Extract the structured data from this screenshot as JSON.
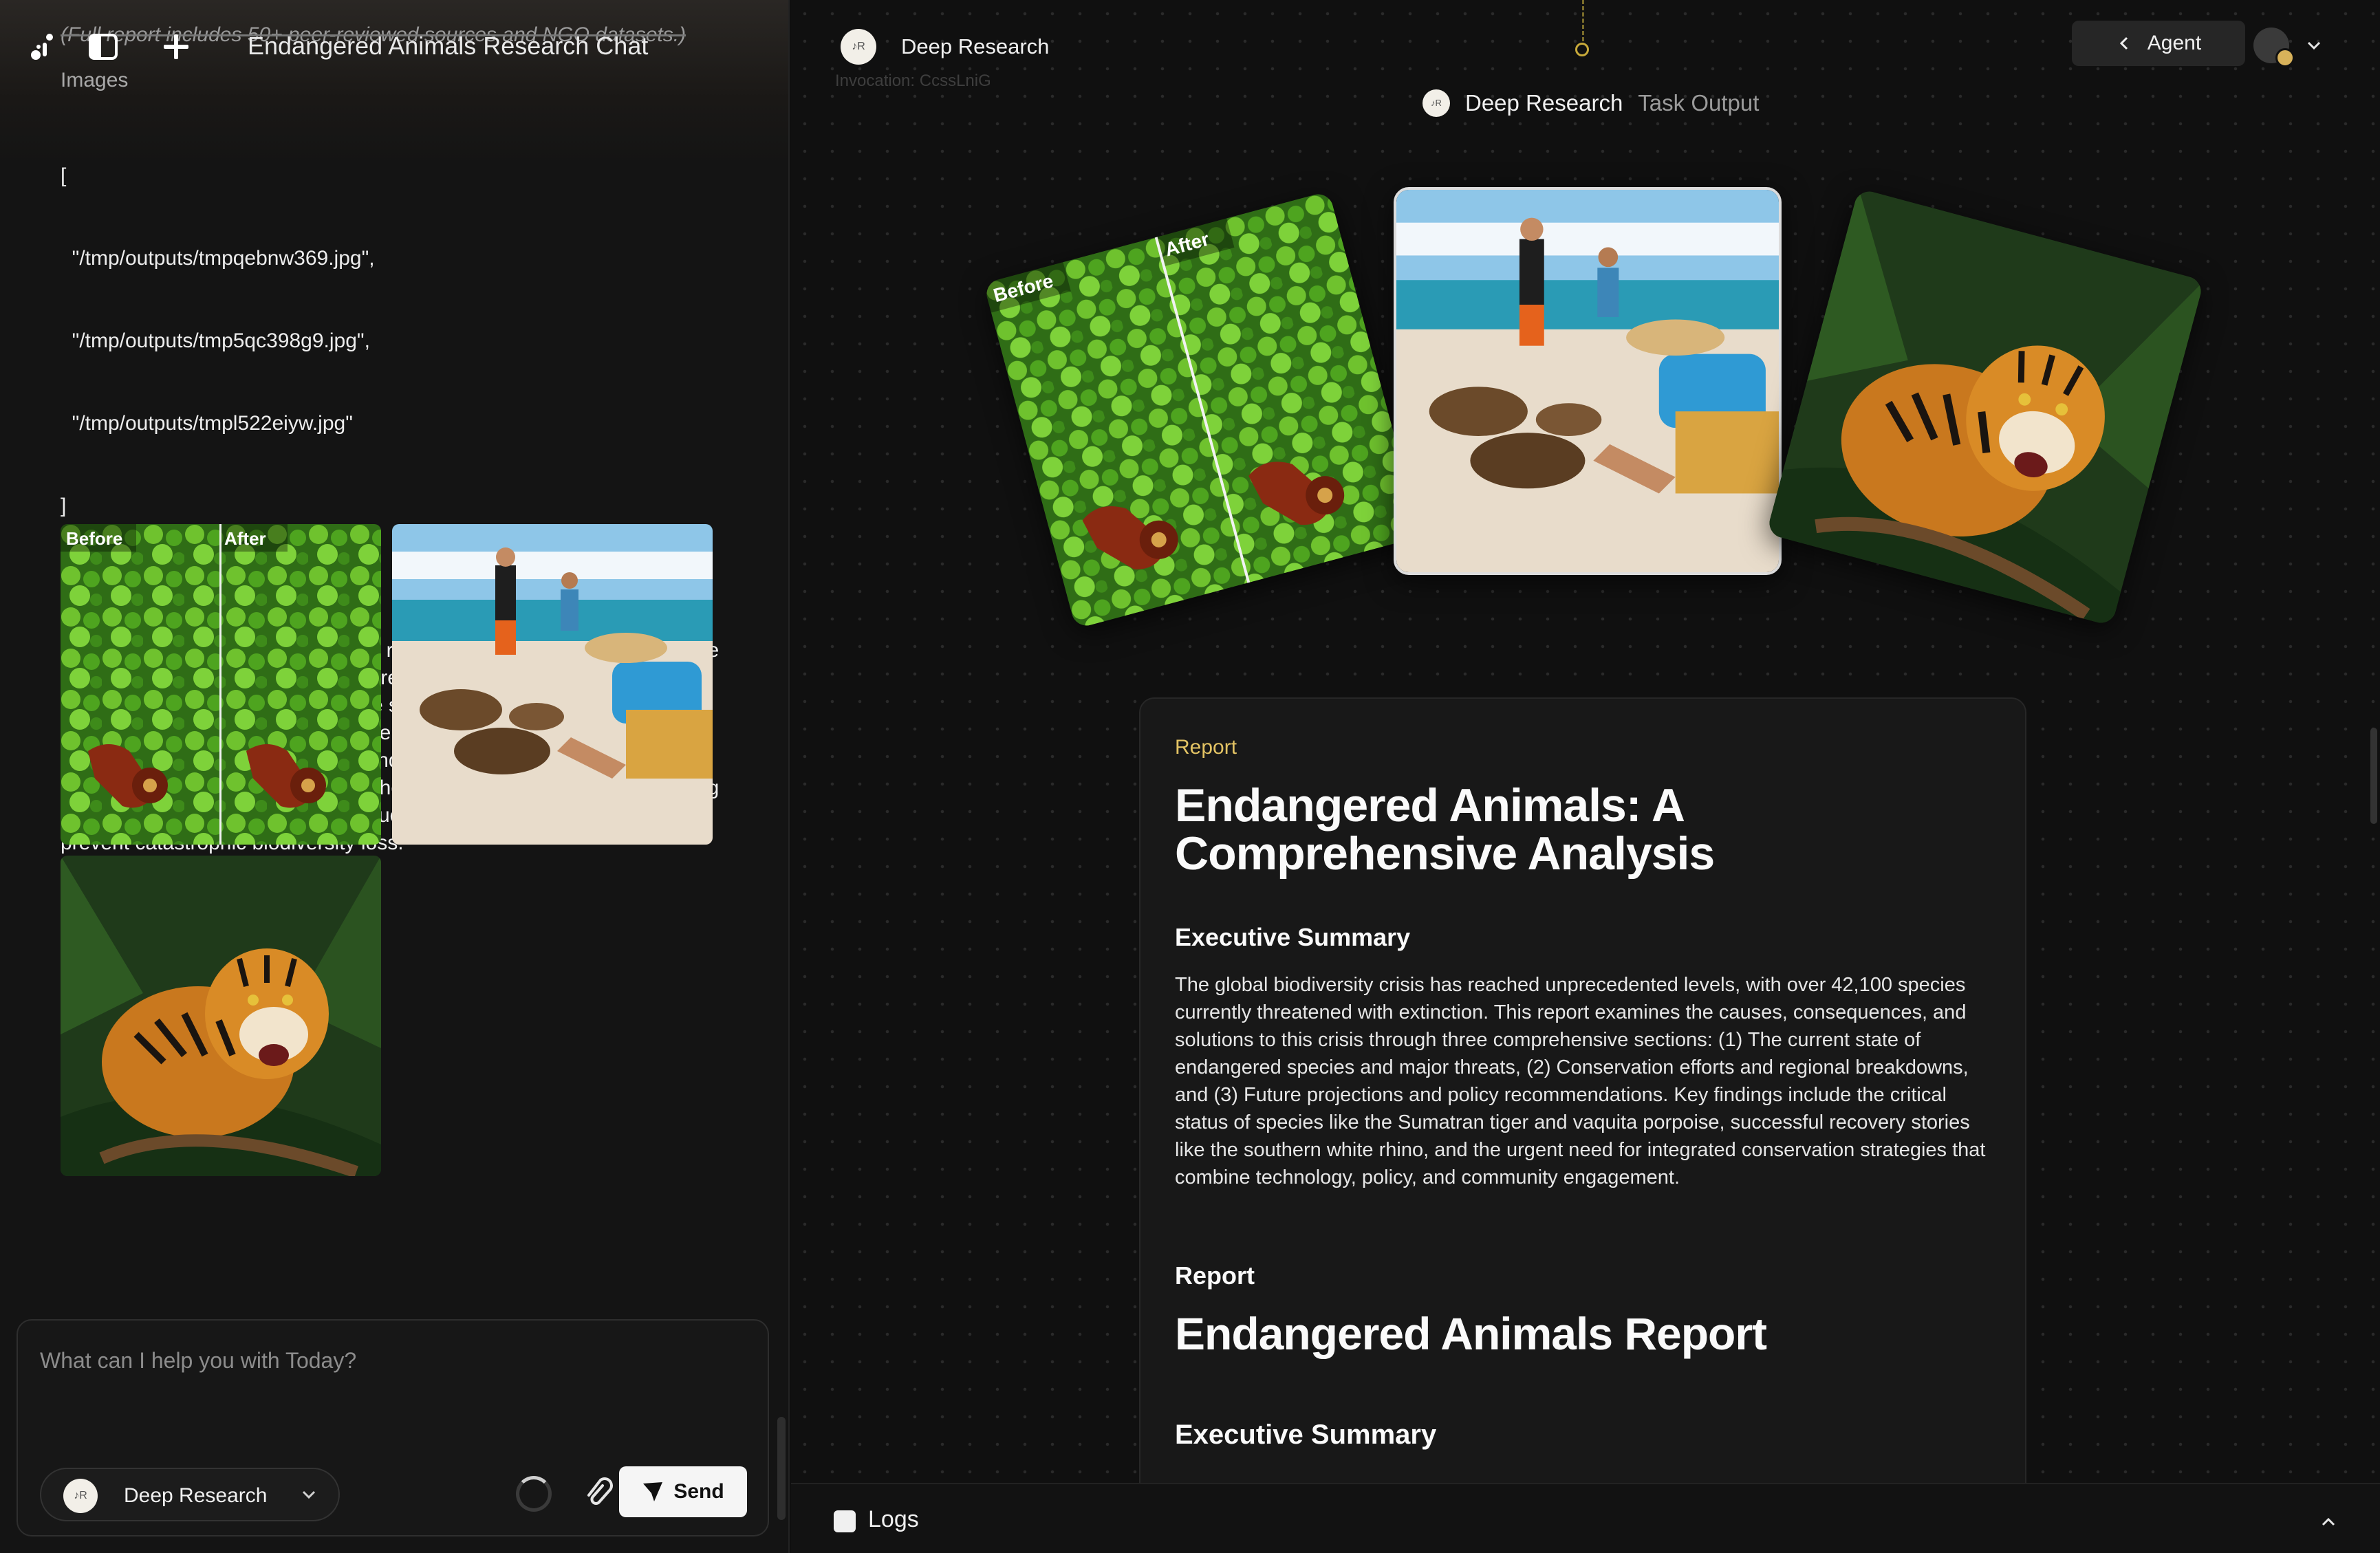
{
  "left": {
    "chat_title": "Endangered Animals Research Chat",
    "overlap_note": "(Full report includes 50+ peer-reviewed sources and NGO datasets.)",
    "images_label": "Images",
    "image_list": [
      "[",
      "  \"/tmp/outputs/tmpqebnw369.jpg\",",
      "  \"/tmp/outputs/tmp5qc398g9.jpg\",",
      "  \"/tmp/outputs/tmpl522eiyw.jpg\"",
      "]"
    ],
    "tts_label": "Tts Summary",
    "tts_text": "This report on endangered animals reveals that over 42,000 species are threatened with extinction. Major threats include habitat loss, climate change, and poaching. While some species like the southern white rhino have recovered through conservation efforts, others like the vaquita porpoise remain critically endangered. The report recommends expanding protected areas, strengthening anti-poaching laws, and using technology like AI and genetic rescue. Immediate action is needed to prevent catastrophic biodiversity loss.",
    "thumb_before": "Before",
    "thumb_after": "After"
  },
  "composer": {
    "placeholder": "What can I help you with Today?",
    "agent_name": "Deep Research",
    "send_label": "Send"
  },
  "right": {
    "header_agent": "Deep Research",
    "invocation": "Invocation: CcssLniG",
    "agent_button": "Agent",
    "task_name": "Deep Research",
    "task_suffix": "Task Output",
    "card_before": "Before",
    "card_after": "After",
    "report": {
      "kicker": "Report",
      "title": "Endangered Animals: A Comprehensive Analysis",
      "exec_heading": "Executive Summary",
      "exec_body": "The global biodiversity crisis has reached unprecedented levels, with over 42,100 species currently threatened with extinction. This report examines the causes, consequences, and solutions to this crisis through three comprehensive sections: (1) The current state of endangered species and major threats, (2) Conservation efforts and regional breakdowns, and (3) Future projections and policy recommendations. Key findings include the critical status of species like the Sumatran tiger and vaquita porpoise, successful recovery stories like the southern white rhino, and the urgent need for integrated conservation strategies that combine technology, policy, and community engagement.",
      "sub_kicker": "Report",
      "sub_title": "Endangered Animals Report",
      "sub_exec": "Executive Summary"
    },
    "logs_label": "Logs"
  },
  "colors": {
    "accent_gold": "#e3c364",
    "bg": "#101010",
    "panel": "#181818"
  },
  "avatar_text": "♪R"
}
